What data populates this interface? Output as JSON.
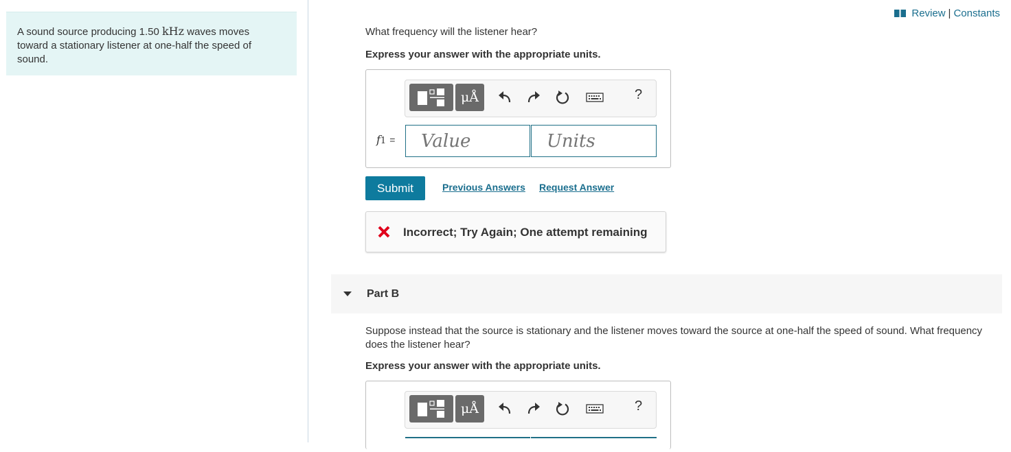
{
  "problem": {
    "text_before": "A sound source producing 1.50 ",
    "unit": "kHz",
    "text_after": " waves moves toward a stationary listener at one-half the speed of sound."
  },
  "header": {
    "review_label": "Review",
    "separator": "|",
    "constants_label": "Constants"
  },
  "part_a": {
    "question": "What frequency will the listener hear?",
    "instruction": "Express your answer with the appropriate units.",
    "toolbar": {
      "units_button": "μÅ",
      "help_label": "?"
    },
    "variable": "f",
    "variable_sub": "1",
    "equals": "=",
    "value_placeholder": "Value",
    "units_placeholder": "Units",
    "submit_label": "Submit",
    "previous_answers_label": "Previous Answers",
    "request_answer_label": "Request Answer",
    "feedback": "Incorrect; Try Again; One attempt remaining"
  },
  "part_b": {
    "title": "Part B",
    "question": "Suppose instead that the source is stationary and the listener moves toward the source at one-half the speed of sound. What frequency does the listener hear?",
    "instruction": "Express your answer with the appropriate units.",
    "toolbar": {
      "units_button": "μÅ",
      "help_label": "?"
    }
  },
  "colors": {
    "accent": "#0e7b9e",
    "link": "#1a6e8e",
    "problem_bg": "#e4f5f5",
    "error": "#e0001b"
  },
  "icons": [
    "book-icon",
    "templates-icon",
    "undo-icon",
    "redo-icon",
    "reset-icon",
    "keyboard-icon",
    "error-x-icon",
    "caret-down-icon"
  ]
}
